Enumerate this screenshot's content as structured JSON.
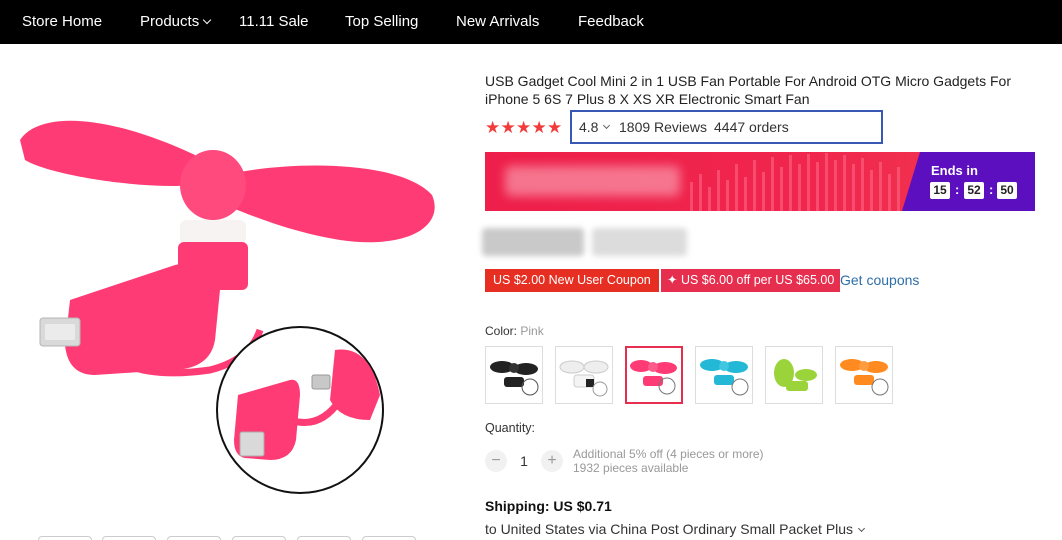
{
  "nav": {
    "items": [
      "Store Home",
      "Products",
      "11.11 Sale",
      "Top Selling",
      "New Arrivals",
      "Feedback"
    ]
  },
  "product": {
    "title": "USB Gadget Cool Mini 2 in 1 USB Fan Portable For Android OTG Micro Gadgets For iPhone 5 6S 7 Plus 8 X XS XR Electronic Smart Fan",
    "rating": "4.8",
    "stars": 5,
    "reviews": "1809 Reviews",
    "orders": "4447 orders"
  },
  "flash_deal": {
    "ends_label": "Ends in",
    "hours": "15",
    "minutes": "52",
    "seconds": "50"
  },
  "coupons": {
    "coupon1": "US $2.00 New User Coupon",
    "coupon2": "US $6.00 off per US $65.00",
    "get_coupons": "Get coupons"
  },
  "color": {
    "label": "Color:",
    "selected": "Pink",
    "options": [
      "black",
      "white",
      "pink",
      "cyan",
      "green",
      "orange"
    ],
    "option_colors": [
      "#222222",
      "#eeeeee",
      "#ff3b75",
      "#22b8d6",
      "#9bd43a",
      "#ff8a1f"
    ]
  },
  "quantity": {
    "label": "Quantity:",
    "minus": "−",
    "value": "1",
    "plus": "+",
    "discount_note": "Additional 5% off (4 pieces or more)",
    "available": "1932 pieces available"
  },
  "shipping": {
    "title": "Shipping: US $0.71",
    "detail": "to United States via China Post Ordinary Small Packet Plus"
  },
  "colors": {
    "nav_bg": "#000000",
    "star": "#f23c3c",
    "highlight_box": "#3957b5",
    "banner": "#ee1f4a",
    "countdown_panel": "#5c0fbf",
    "coupon": "#e62e22",
    "product_pink": "#ff3b75"
  }
}
